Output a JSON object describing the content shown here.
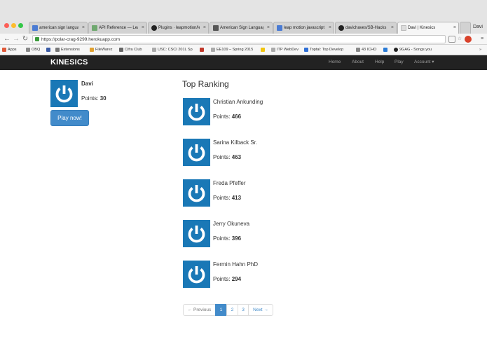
{
  "browser": {
    "tabs": [
      {
        "label": "american sign languag",
        "favicon_color": "#4a7bd3"
      },
      {
        "label": "API Reference — Leap",
        "favicon_color": "#6fa86f"
      },
      {
        "label": "Plugins · leapmotion/le",
        "favicon_color": "#222222"
      },
      {
        "label": "American Sign Languag",
        "favicon_color": "#555555"
      },
      {
        "label": "leap motion javascript",
        "favicon_color": "#4a7bd3"
      },
      {
        "label": "davichaves/SB-Hacks",
        "favicon_color": "#222222"
      },
      {
        "label": "Davi | Kinesics",
        "favicon_color": "#dddddd"
      }
    ],
    "user_label": "Davi",
    "url": "https://polar-crag-9299.herokuapp.com",
    "bookmarks": [
      {
        "label": "Apps",
        "icon_color": "#e05a3a"
      },
      {
        "label": "OBQ",
        "icon_color": "#888888"
      },
      {
        "label": "",
        "icon_color": "#3b5ba5"
      },
      {
        "label": "Extensions",
        "icon_color": "#777777"
      },
      {
        "label": "FileWarez",
        "icon_color": "#e0a030"
      },
      {
        "label": "Cifra Club",
        "icon_color": "#666666"
      },
      {
        "label": "USC: CSCI 201L Sp",
        "icon_color": "#aaaaaa"
      },
      {
        "label": "",
        "icon_color": "#c0392b"
      },
      {
        "label": "EE109 – Spring 2015",
        "icon_color": "#aaaaaa"
      },
      {
        "label": "",
        "icon_color": "#f1c40f"
      },
      {
        "label": "ITP WebDev",
        "icon_color": "#aaaaaa"
      },
      {
        "label": "Toptal: Top Develop",
        "icon_color": "#2f6fd6"
      },
      {
        "label": "43 ICHO",
        "icon_color": "#888888"
      },
      {
        "label": "",
        "icon_color": "#2a7bd6"
      },
      {
        "label": "9GAG - Songs you",
        "icon_color": "#222222"
      }
    ]
  },
  "app": {
    "brand": "KINESICS",
    "nav": [
      "Home",
      "About",
      "Help",
      "Play",
      "Account ▾"
    ],
    "user": {
      "name": "Davi",
      "points_label": "Points:",
      "points": "30"
    },
    "play_button": "Play now!",
    "ranking_title": "Top Ranking",
    "points_label": "Points:",
    "ranking": [
      {
        "name": "Christian Ankunding",
        "points": "466"
      },
      {
        "name": "Sarina Kilback Sr.",
        "points": "463"
      },
      {
        "name": "Freda Pfeffer",
        "points": "413"
      },
      {
        "name": "Jerry Okuneva",
        "points": "396"
      },
      {
        "name": "Fermin Hahn PhD",
        "points": "294"
      }
    ],
    "pagination": {
      "previous": "← Previous",
      "pages": [
        "1",
        "2",
        "3"
      ],
      "next": "Next →",
      "active_page": "1"
    },
    "colors": {
      "avatar": "#1a78b6",
      "primary": "#428bca",
      "navbar": "#222222"
    }
  }
}
